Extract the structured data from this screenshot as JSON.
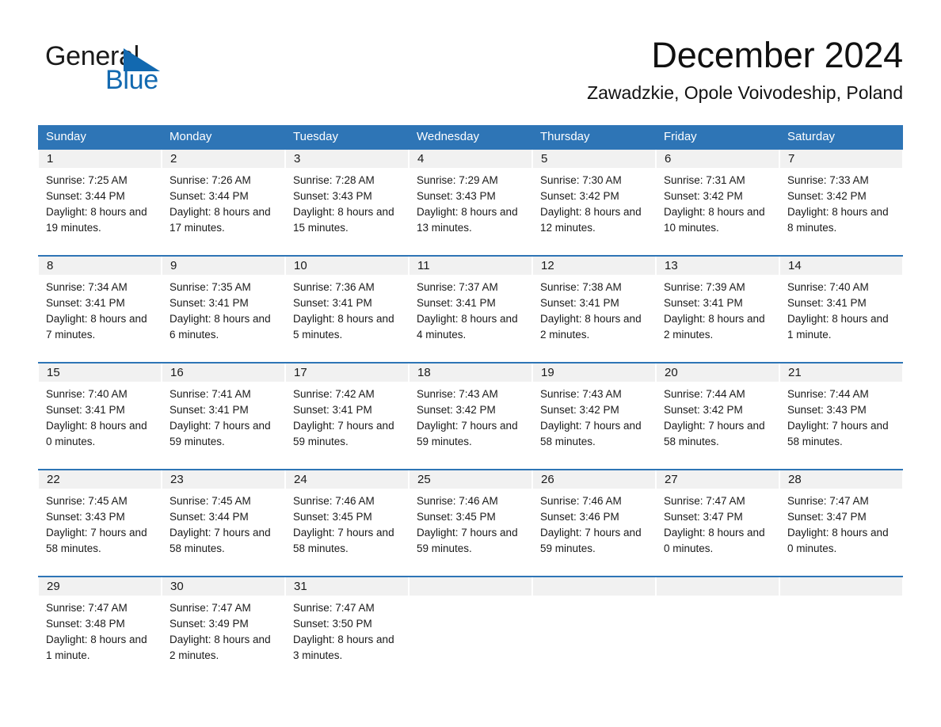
{
  "brand": {
    "name_part1": "General",
    "name_part2": "Blue",
    "triangle_color": "#1269b0",
    "accent_color": "#2e75b6"
  },
  "header": {
    "title": "December 2024",
    "location": "Zawadzkie, Opole Voivodeship, Poland"
  },
  "calendar": {
    "weekday_headers": [
      "Sunday",
      "Monday",
      "Tuesday",
      "Wednesday",
      "Thursday",
      "Friday",
      "Saturday"
    ],
    "weeks": [
      [
        {
          "day": "1",
          "sunrise": "Sunrise: 7:25 AM",
          "sunset": "Sunset: 3:44 PM",
          "daylight": "Daylight: 8 hours and 19 minutes."
        },
        {
          "day": "2",
          "sunrise": "Sunrise: 7:26 AM",
          "sunset": "Sunset: 3:44 PM",
          "daylight": "Daylight: 8 hours and 17 minutes."
        },
        {
          "day": "3",
          "sunrise": "Sunrise: 7:28 AM",
          "sunset": "Sunset: 3:43 PM",
          "daylight": "Daylight: 8 hours and 15 minutes."
        },
        {
          "day": "4",
          "sunrise": "Sunrise: 7:29 AM",
          "sunset": "Sunset: 3:43 PM",
          "daylight": "Daylight: 8 hours and 13 minutes."
        },
        {
          "day": "5",
          "sunrise": "Sunrise: 7:30 AM",
          "sunset": "Sunset: 3:42 PM",
          "daylight": "Daylight: 8 hours and 12 minutes."
        },
        {
          "day": "6",
          "sunrise": "Sunrise: 7:31 AM",
          "sunset": "Sunset: 3:42 PM",
          "daylight": "Daylight: 8 hours and 10 minutes."
        },
        {
          "day": "7",
          "sunrise": "Sunrise: 7:33 AM",
          "sunset": "Sunset: 3:42 PM",
          "daylight": "Daylight: 8 hours and 8 minutes."
        }
      ],
      [
        {
          "day": "8",
          "sunrise": "Sunrise: 7:34 AM",
          "sunset": "Sunset: 3:41 PM",
          "daylight": "Daylight: 8 hours and 7 minutes."
        },
        {
          "day": "9",
          "sunrise": "Sunrise: 7:35 AM",
          "sunset": "Sunset: 3:41 PM",
          "daylight": "Daylight: 8 hours and 6 minutes."
        },
        {
          "day": "10",
          "sunrise": "Sunrise: 7:36 AM",
          "sunset": "Sunset: 3:41 PM",
          "daylight": "Daylight: 8 hours and 5 minutes."
        },
        {
          "day": "11",
          "sunrise": "Sunrise: 7:37 AM",
          "sunset": "Sunset: 3:41 PM",
          "daylight": "Daylight: 8 hours and 4 minutes."
        },
        {
          "day": "12",
          "sunrise": "Sunrise: 7:38 AM",
          "sunset": "Sunset: 3:41 PM",
          "daylight": "Daylight: 8 hours and 2 minutes."
        },
        {
          "day": "13",
          "sunrise": "Sunrise: 7:39 AM",
          "sunset": "Sunset: 3:41 PM",
          "daylight": "Daylight: 8 hours and 2 minutes."
        },
        {
          "day": "14",
          "sunrise": "Sunrise: 7:40 AM",
          "sunset": "Sunset: 3:41 PM",
          "daylight": "Daylight: 8 hours and 1 minute."
        }
      ],
      [
        {
          "day": "15",
          "sunrise": "Sunrise: 7:40 AM",
          "sunset": "Sunset: 3:41 PM",
          "daylight": "Daylight: 8 hours and 0 minutes."
        },
        {
          "day": "16",
          "sunrise": "Sunrise: 7:41 AM",
          "sunset": "Sunset: 3:41 PM",
          "daylight": "Daylight: 7 hours and 59 minutes."
        },
        {
          "day": "17",
          "sunrise": "Sunrise: 7:42 AM",
          "sunset": "Sunset: 3:41 PM",
          "daylight": "Daylight: 7 hours and 59 minutes."
        },
        {
          "day": "18",
          "sunrise": "Sunrise: 7:43 AM",
          "sunset": "Sunset: 3:42 PM",
          "daylight": "Daylight: 7 hours and 59 minutes."
        },
        {
          "day": "19",
          "sunrise": "Sunrise: 7:43 AM",
          "sunset": "Sunset: 3:42 PM",
          "daylight": "Daylight: 7 hours and 58 minutes."
        },
        {
          "day": "20",
          "sunrise": "Sunrise: 7:44 AM",
          "sunset": "Sunset: 3:42 PM",
          "daylight": "Daylight: 7 hours and 58 minutes."
        },
        {
          "day": "21",
          "sunrise": "Sunrise: 7:44 AM",
          "sunset": "Sunset: 3:43 PM",
          "daylight": "Daylight: 7 hours and 58 minutes."
        }
      ],
      [
        {
          "day": "22",
          "sunrise": "Sunrise: 7:45 AM",
          "sunset": "Sunset: 3:43 PM",
          "daylight": "Daylight: 7 hours and 58 minutes."
        },
        {
          "day": "23",
          "sunrise": "Sunrise: 7:45 AM",
          "sunset": "Sunset: 3:44 PM",
          "daylight": "Daylight: 7 hours and 58 minutes."
        },
        {
          "day": "24",
          "sunrise": "Sunrise: 7:46 AM",
          "sunset": "Sunset: 3:45 PM",
          "daylight": "Daylight: 7 hours and 58 minutes."
        },
        {
          "day": "25",
          "sunrise": "Sunrise: 7:46 AM",
          "sunset": "Sunset: 3:45 PM",
          "daylight": "Daylight: 7 hours and 59 minutes."
        },
        {
          "day": "26",
          "sunrise": "Sunrise: 7:46 AM",
          "sunset": "Sunset: 3:46 PM",
          "daylight": "Daylight: 7 hours and 59 minutes."
        },
        {
          "day": "27",
          "sunrise": "Sunrise: 7:47 AM",
          "sunset": "Sunset: 3:47 PM",
          "daylight": "Daylight: 8 hours and 0 minutes."
        },
        {
          "day": "28",
          "sunrise": "Sunrise: 7:47 AM",
          "sunset": "Sunset: 3:47 PM",
          "daylight": "Daylight: 8 hours and 0 minutes."
        }
      ],
      [
        {
          "day": "29",
          "sunrise": "Sunrise: 7:47 AM",
          "sunset": "Sunset: 3:48 PM",
          "daylight": "Daylight: 8 hours and 1 minute."
        },
        {
          "day": "30",
          "sunrise": "Sunrise: 7:47 AM",
          "sunset": "Sunset: 3:49 PM",
          "daylight": "Daylight: 8 hours and 2 minutes."
        },
        {
          "day": "31",
          "sunrise": "Sunrise: 7:47 AM",
          "sunset": "Sunset: 3:50 PM",
          "daylight": "Daylight: 8 hours and 3 minutes."
        },
        {
          "day": "",
          "sunrise": "",
          "sunset": "",
          "daylight": ""
        },
        {
          "day": "",
          "sunrise": "",
          "sunset": "",
          "daylight": ""
        },
        {
          "day": "",
          "sunrise": "",
          "sunset": "",
          "daylight": ""
        },
        {
          "day": "",
          "sunrise": "",
          "sunset": "",
          "daylight": ""
        }
      ]
    ]
  }
}
